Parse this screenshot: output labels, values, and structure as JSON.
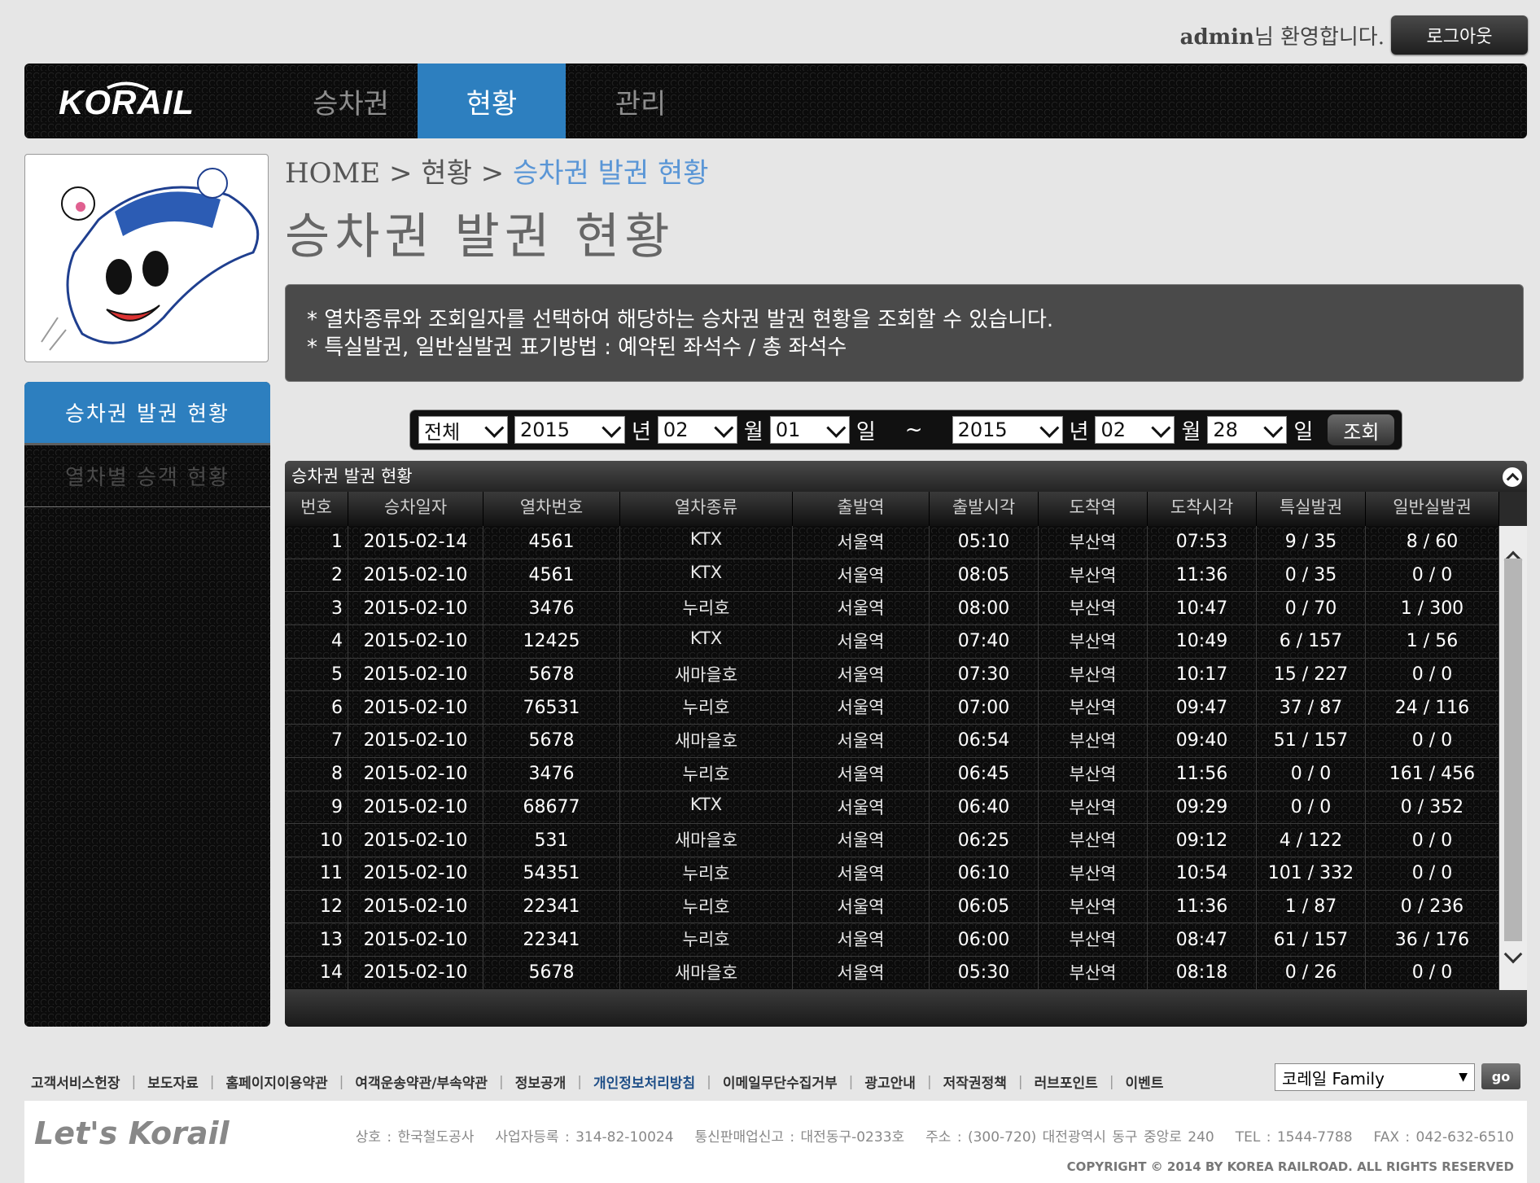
{
  "user": {
    "id": "admin",
    "welcome_suffix": "님 환영합니다.",
    "logout_label": "로그아웃"
  },
  "logo": {
    "text": "KORAIL"
  },
  "nav": [
    {
      "label": "승차권",
      "active": false
    },
    {
      "label": "현황",
      "active": true
    },
    {
      "label": "관리",
      "active": false
    }
  ],
  "sidemenu": [
    {
      "label": "승차권 발권 현황",
      "active": true
    },
    {
      "label": "열차별 승객 현황",
      "active": false
    }
  ],
  "breadcrumb": {
    "home": "HOME",
    "sep": ">",
    "level1": "현황",
    "current": "승차권 발권 현황"
  },
  "page_title": "승차권 발권 현황",
  "info": [
    "* 열차종류와 조회일자를 선택하여 해당하는 승차권 발권 현황을 조회할 수 있습니다.",
    "* 특실발권, 일반실발권 표기방법 : 예약된 좌석수 / 총 좌석수"
  ],
  "search": {
    "train_type": "전체",
    "from_year": "2015",
    "from_month": "02",
    "from_day": "01",
    "to_year": "2015",
    "to_month": "02",
    "to_day": "28",
    "year_unit": "년",
    "month_unit": "월",
    "day_unit": "일",
    "tilde": "~",
    "button_label": "조회"
  },
  "table": {
    "title": "승차권 발권 현황",
    "columns": [
      "번호",
      "승차일자",
      "열차번호",
      "열차종류",
      "출발역",
      "출발시각",
      "도착역",
      "도착시각",
      "특실발권",
      "일반실발권"
    ],
    "rows": [
      [
        "1",
        "2015-02-14",
        "4561",
        "KTX",
        "서울역",
        "05:10",
        "부산역",
        "07:53",
        "9 / 35",
        "8 / 60"
      ],
      [
        "2",
        "2015-02-10",
        "4561",
        "KTX",
        "서울역",
        "08:05",
        "부산역",
        "11:36",
        "0 / 35",
        "0 / 0"
      ],
      [
        "3",
        "2015-02-10",
        "3476",
        "누리호",
        "서울역",
        "08:00",
        "부산역",
        "10:47",
        "0 / 70",
        "1 / 300"
      ],
      [
        "4",
        "2015-02-10",
        "12425",
        "KTX",
        "서울역",
        "07:40",
        "부산역",
        "10:49",
        "6 / 157",
        "1 / 56"
      ],
      [
        "5",
        "2015-02-10",
        "5678",
        "새마을호",
        "서울역",
        "07:30",
        "부산역",
        "10:17",
        "15 / 227",
        "0 / 0"
      ],
      [
        "6",
        "2015-02-10",
        "76531",
        "누리호",
        "서울역",
        "07:00",
        "부산역",
        "09:47",
        "37 / 87",
        "24 / 116"
      ],
      [
        "7",
        "2015-02-10",
        "5678",
        "새마을호",
        "서울역",
        "06:54",
        "부산역",
        "09:40",
        "51 / 157",
        "0 / 0"
      ],
      [
        "8",
        "2015-02-10",
        "3476",
        "누리호",
        "서울역",
        "06:45",
        "부산역",
        "11:56",
        "0 / 0",
        "161 / 456"
      ],
      [
        "9",
        "2015-02-10",
        "68677",
        "KTX",
        "서울역",
        "06:40",
        "부산역",
        "09:29",
        "0 / 0",
        "0 / 352"
      ],
      [
        "10",
        "2015-02-10",
        "531",
        "새마을호",
        "서울역",
        "06:25",
        "부산역",
        "09:12",
        "4 / 122",
        "0 / 0"
      ],
      [
        "11",
        "2015-02-10",
        "54351",
        "누리호",
        "서울역",
        "06:10",
        "부산역",
        "10:54",
        "101 / 332",
        "0 / 0"
      ],
      [
        "12",
        "2015-02-10",
        "22341",
        "누리호",
        "서울역",
        "06:05",
        "부산역",
        "11:36",
        "1 / 87",
        "0 / 236"
      ],
      [
        "13",
        "2015-02-10",
        "22341",
        "누리호",
        "서울역",
        "06:00",
        "부산역",
        "08:47",
        "61 / 157",
        "36 / 176"
      ],
      [
        "14",
        "2015-02-10",
        "5678",
        "새마을호",
        "서울역",
        "05:30",
        "부산역",
        "08:18",
        "0 / 26",
        "0 / 0"
      ]
    ]
  },
  "footer": {
    "links": [
      "고객서비스헌장",
      "보도자료",
      "홈페이지이용약관",
      "여객운송약관/부속약관",
      "정보공개",
      "개인정보처리방침",
      "이메일무단수집거부",
      "광고안내",
      "저작권정책",
      "러브포인트",
      "이벤트"
    ],
    "highlighted_link": "개인정보처리방침",
    "family_select": "코레일 Family",
    "go_label": "go",
    "brand": "Let's Korail",
    "company": [
      "상호 : 한국철도공사",
      "사업자등록 : 314-82-10024",
      "통신판매업신고 : 대전동구-0233호",
      "주소 : (300-720) 대전광역시 동구 중앙로 240",
      "TEL : 1544-7788",
      "FAX : 042-632-6510"
    ],
    "copyright": "COPYRIGHT © 2014 BY KOREA RAILROAD. ALL RIGHTS RESERVED"
  },
  "colors": {
    "accent": "#2d7fbf",
    "breadcrumb_current": "#5a96d6",
    "panel_bg": "#4a4a4a"
  }
}
